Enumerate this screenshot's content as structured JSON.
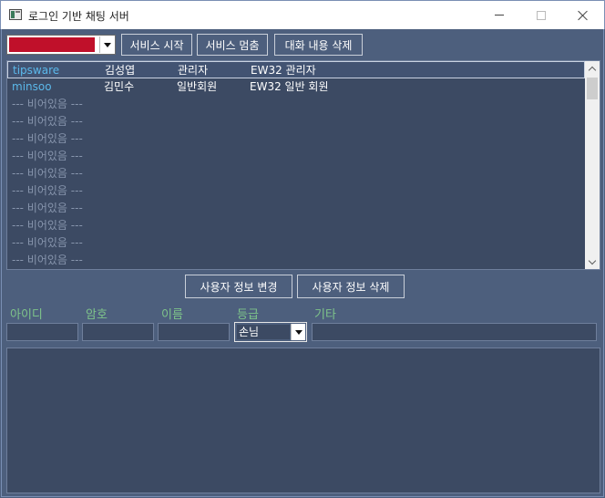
{
  "window": {
    "title": "로그인 기반 채팅 서버"
  },
  "toolbar": {
    "selected_value": "",
    "start_label": "서비스 시작",
    "stop_label": "서비스 멈춤",
    "clear_label": "대화 내용 삭제"
  },
  "users": [
    {
      "id": "tipsware",
      "name": "김성엽",
      "grade": "관리자",
      "etc": "EW32 관리자"
    },
    {
      "id": "minsoo",
      "name": "김민수",
      "grade": "일반회원",
      "etc": "EW32 일반 회원"
    },
    {
      "id": "--- 비어있음 ---"
    },
    {
      "id": "--- 비어있음 ---"
    },
    {
      "id": "--- 비어있음 ---"
    },
    {
      "id": "--- 비어있음 ---"
    },
    {
      "id": "--- 비어있음 ---"
    },
    {
      "id": "--- 비어있음 ---"
    },
    {
      "id": "--- 비어있음 ---"
    },
    {
      "id": "--- 비어있음 ---"
    },
    {
      "id": "--- 비어있음 ---"
    },
    {
      "id": "--- 비어있음 ---"
    }
  ],
  "user_actions": {
    "modify_label": "사용자 정보 변경",
    "delete_label": "사용자 정보 삭제"
  },
  "form": {
    "id_label": "아이디",
    "password_label": "암호",
    "name_label": "이름",
    "grade_label": "등급",
    "etc_label": "기타",
    "id_value": "",
    "password_value": "",
    "name_value": "",
    "grade_value": "손님",
    "etc_value": ""
  },
  "colors": {
    "background": "#4d5f7d",
    "panel": "#3c4a63",
    "id_text": "#5bb8ea",
    "label_text": "#7ec48a",
    "combo_redacted": "#c0102a"
  }
}
